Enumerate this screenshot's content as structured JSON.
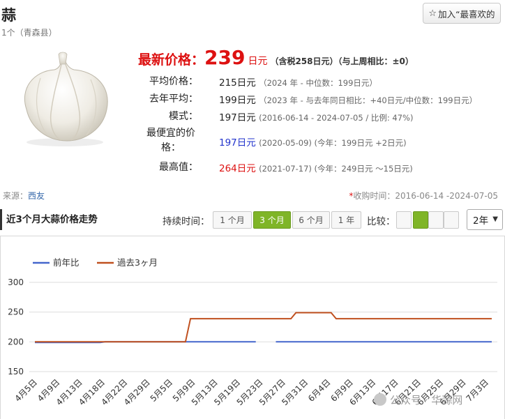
{
  "header": {
    "title": "蒜",
    "subtitle": "1个（青森县）",
    "fav_label": "加入“最喜欢的"
  },
  "latest": {
    "label": "最新价格：",
    "price": "239",
    "unit": "日元",
    "tax_note": "（含税258日元）（与上周相比：±0）"
  },
  "stats": {
    "average": {
      "label": "平均价格：",
      "value": "215日元",
      "note": "（2024 年 - 中位数：199日元）"
    },
    "last_year": {
      "label": "去年平均：",
      "value": "199日元",
      "note_a": "（2023 年 - 与去年同日相比：",
      "diff": "+40日元",
      "note_b": "/中位数：199日元）"
    },
    "mode": {
      "label": "模式：",
      "value": "197日元",
      "note": "(2016-06-14 - 2024-07-05 / 比例: 47%)"
    },
    "cheapest": {
      "label_1": "最便宜的价",
      "label_2": "格：",
      "value": "197日元",
      "note_a": "(2020-05-09) (今年：199日元 ",
      "diff": "+2日元",
      "note_b": ")"
    },
    "highest": {
      "label": "最高值：",
      "value": "264日元",
      "note_a": "(2021-07-17) (今年：249日元 ",
      "diff": "～15日元",
      "note_b": ")"
    }
  },
  "source": {
    "label": "来源：",
    "link": "西友"
  },
  "collected": {
    "mark": "*",
    "text": "收购时间：2016-06-14 -2024-07-05"
  },
  "controls": {
    "section_title": "近3个月大蒜价格走势",
    "duration_label": "持续时间：",
    "durations": [
      "1 个月",
      "3 个月",
      "6 个月",
      "1 年"
    ],
    "active_duration": "3 个月",
    "compare_label": "比较：",
    "compare_selected": 2,
    "year_select": "2年"
  },
  "watermark": "公众号 · 华蒜网",
  "colors": {
    "series_prev": "#4466cc",
    "series_3m": "#c0501f",
    "accent_green": "#7fb527",
    "price_red": "#dd1111"
  },
  "chart_data": {
    "type": "line",
    "title": "",
    "xlabel": "",
    "ylabel": "",
    "ylim": [
      150,
      300
    ],
    "yticks": [
      150,
      200,
      250,
      300
    ],
    "grid": true,
    "legend": "top-left",
    "x_ticks": [
      "4月5日",
      "4月9日",
      "4月13日",
      "4月18日",
      "4月22日",
      "4月29日",
      "5月5日",
      "5月9日",
      "5月13日",
      "5月19日",
      "5月23日",
      "5月27日",
      "5月31日",
      "6月4日",
      "6月9日",
      "6月13日",
      "6月17日",
      "6月21日",
      "6月25日",
      "6月29日",
      "7月3日"
    ],
    "x_range": [
      "2024-04-05",
      "2024-07-05"
    ],
    "series": [
      {
        "name": "前年比",
        "color": "#4466cc",
        "segments": [
          [
            [
              "2024-04-05",
              199
            ],
            [
              "2024-04-18",
              199
            ],
            [
              "2024-04-19",
              200
            ],
            [
              "2024-05-19",
              200
            ]
          ],
          [
            [
              "2024-05-23",
              200
            ],
            [
              "2024-07-05",
              200
            ]
          ]
        ]
      },
      {
        "name": "過去3ヶ月",
        "color": "#c0501f",
        "segments": [
          [
            [
              "2024-04-05",
              200
            ],
            [
              "2024-05-05",
              200
            ],
            [
              "2024-05-06",
              239
            ],
            [
              "2024-05-26",
              239
            ],
            [
              "2024-05-27",
              249
            ],
            [
              "2024-06-03",
              249
            ],
            [
              "2024-06-04",
              239
            ],
            [
              "2024-07-05",
              239
            ]
          ]
        ]
      }
    ]
  }
}
